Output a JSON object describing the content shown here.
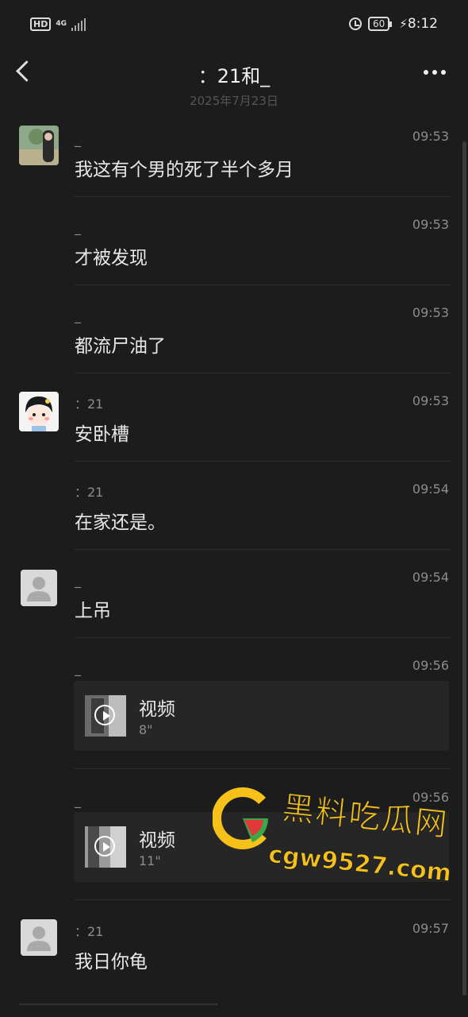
{
  "status_bar": {
    "hd": "HD",
    "network": "4G",
    "battery": "60",
    "time": "8:12"
  },
  "header": {
    "title": "：21和_",
    "date": "2025年7月23日"
  },
  "messages": [
    {
      "sender": "_",
      "time": "09:53",
      "text": "我这有个男的死了半个多月"
    },
    {
      "sender": "_",
      "time": "09:53",
      "text": "才被发现"
    },
    {
      "sender": "_",
      "time": "09:53",
      "text": "都流尸油了"
    },
    {
      "sender": "：21",
      "time": "09:53",
      "text": "安卧槽"
    },
    {
      "sender": "：21",
      "time": "09:54",
      "text": "在家还是。"
    },
    {
      "sender": "_",
      "time": "09:54",
      "text": "上吊"
    },
    {
      "sender": "_",
      "time": "09:56",
      "video_label": "视频",
      "duration": "8\""
    },
    {
      "sender": "_",
      "time": "09:56",
      "video_label": "视频",
      "duration": "11\""
    },
    {
      "sender": "：21",
      "time": "09:57",
      "text": "我日你龟"
    }
  ],
  "watermark": {
    "name": "黑料吃瓜网",
    "url": "cgw9527.com"
  },
  "colors": {
    "background": "#1c1c1c",
    "bubble": "#262626",
    "muted_text": "#8d8d8d",
    "watermark": "#f6c21a"
  }
}
